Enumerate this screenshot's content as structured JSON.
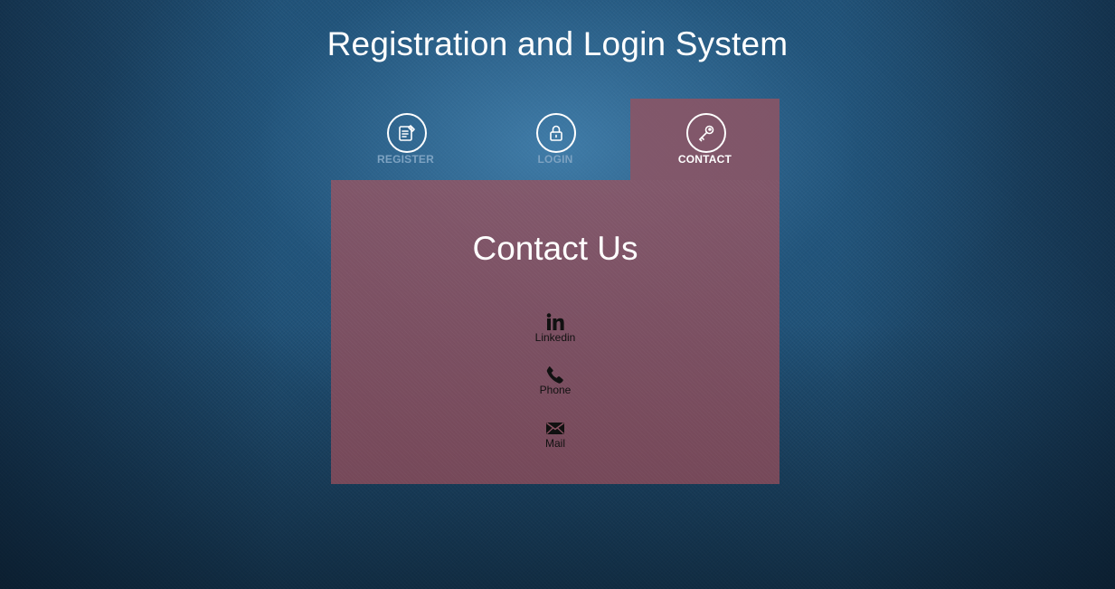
{
  "header": {
    "title": "Registration and Login System"
  },
  "tabs": [
    {
      "label": "REGISTER",
      "icon": "register-form-icon",
      "active": false
    },
    {
      "label": "LOGIN",
      "icon": "padlock-icon",
      "active": false
    },
    {
      "label": "CONTACT",
      "icon": "key-icon",
      "active": true
    }
  ],
  "panel": {
    "title": "Contact Us",
    "links": [
      {
        "label": "Linkedin",
        "icon": "linkedin-icon"
      },
      {
        "label": "Phone",
        "icon": "phone-icon"
      },
      {
        "label": "Mail",
        "icon": "mail-icon"
      }
    ]
  },
  "colors": {
    "background": "#1f4f74",
    "panel": "#8c5464",
    "inactive_tab_text": "#7ea3c2",
    "active_tab_text": "#ffffff",
    "link_text": "#111111"
  }
}
